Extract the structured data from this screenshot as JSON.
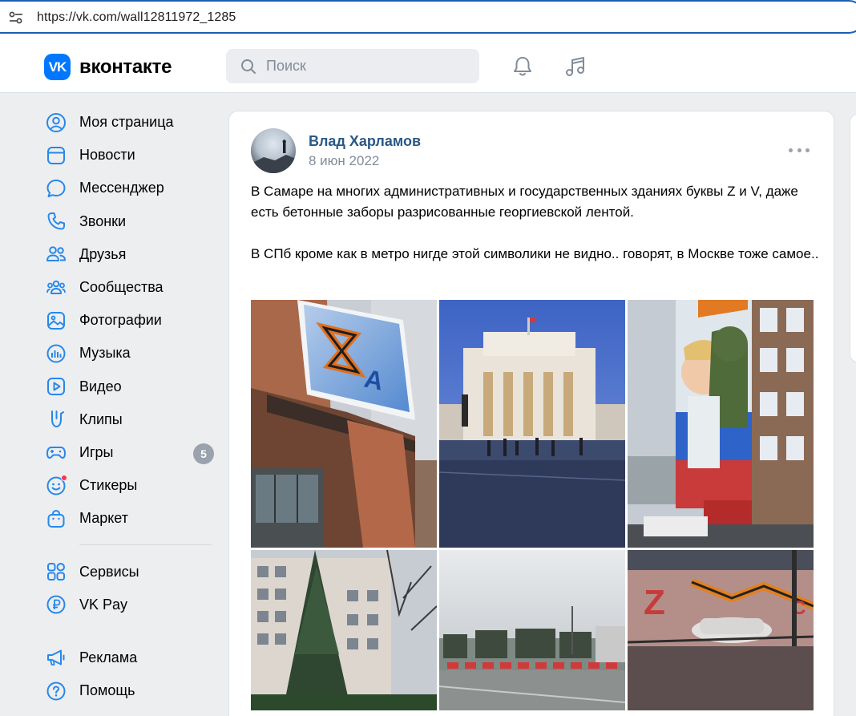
{
  "browser": {
    "url": "https://vk.com/wall12811972_1285"
  },
  "header": {
    "logo_mark": "VK",
    "logo_text": "вконтакте",
    "search_placeholder": "Поиск"
  },
  "sidebar": {
    "items": [
      {
        "label": "Моя страница",
        "icon": "user-circle-icon"
      },
      {
        "label": "Новости",
        "icon": "newsfeed-icon"
      },
      {
        "label": "Мессенджер",
        "icon": "message-icon"
      },
      {
        "label": "Звонки",
        "icon": "phone-icon"
      },
      {
        "label": "Друзья",
        "icon": "friends-icon"
      },
      {
        "label": "Сообщества",
        "icon": "communities-icon"
      },
      {
        "label": "Фотографии",
        "icon": "photos-icon"
      },
      {
        "label": "Музыка",
        "icon": "music-icon"
      },
      {
        "label": "Видео",
        "icon": "video-icon"
      },
      {
        "label": "Клипы",
        "icon": "clips-icon"
      },
      {
        "label": "Игры",
        "icon": "gamepad-icon",
        "badge": "5"
      },
      {
        "label": "Стикеры",
        "icon": "sticker-icon",
        "dot": true
      },
      {
        "label": "Маркет",
        "icon": "market-bag-icon"
      }
    ],
    "items2": [
      {
        "label": "Сервисы",
        "icon": "services-icon"
      },
      {
        "label": "VK Pay",
        "icon": "vkpay-icon"
      }
    ],
    "items3": [
      {
        "label": "Реклама",
        "icon": "megaphone-icon"
      },
      {
        "label": "Помощь",
        "icon": "help-icon"
      }
    ]
  },
  "post": {
    "author": "Влад Харламов",
    "date": "8 июн 2022",
    "paragraph1": "В Самаре на многих административных и государственных зданиях буквы Z и V, даже есть бетонные заборы разрисованные георгиевской лентой.",
    "paragraph2": "В СПб кроме как в метро нигде этой символики не видно.. говорят, в Москве тоже самое..",
    "photos": [
      {
        "name": "photo-building-billboard"
      },
      {
        "name": "photo-theater-square"
      },
      {
        "name": "photo-mural-soldier"
      },
      {
        "name": "photo-apartment-tree"
      },
      {
        "name": "photo-square-fences"
      },
      {
        "name": "photo-concrete-fence"
      }
    ]
  },
  "colors": {
    "accent": "#0077ff",
    "link": "#2a5885",
    "background": "#edeef0",
    "badge": "#99a2ad"
  }
}
